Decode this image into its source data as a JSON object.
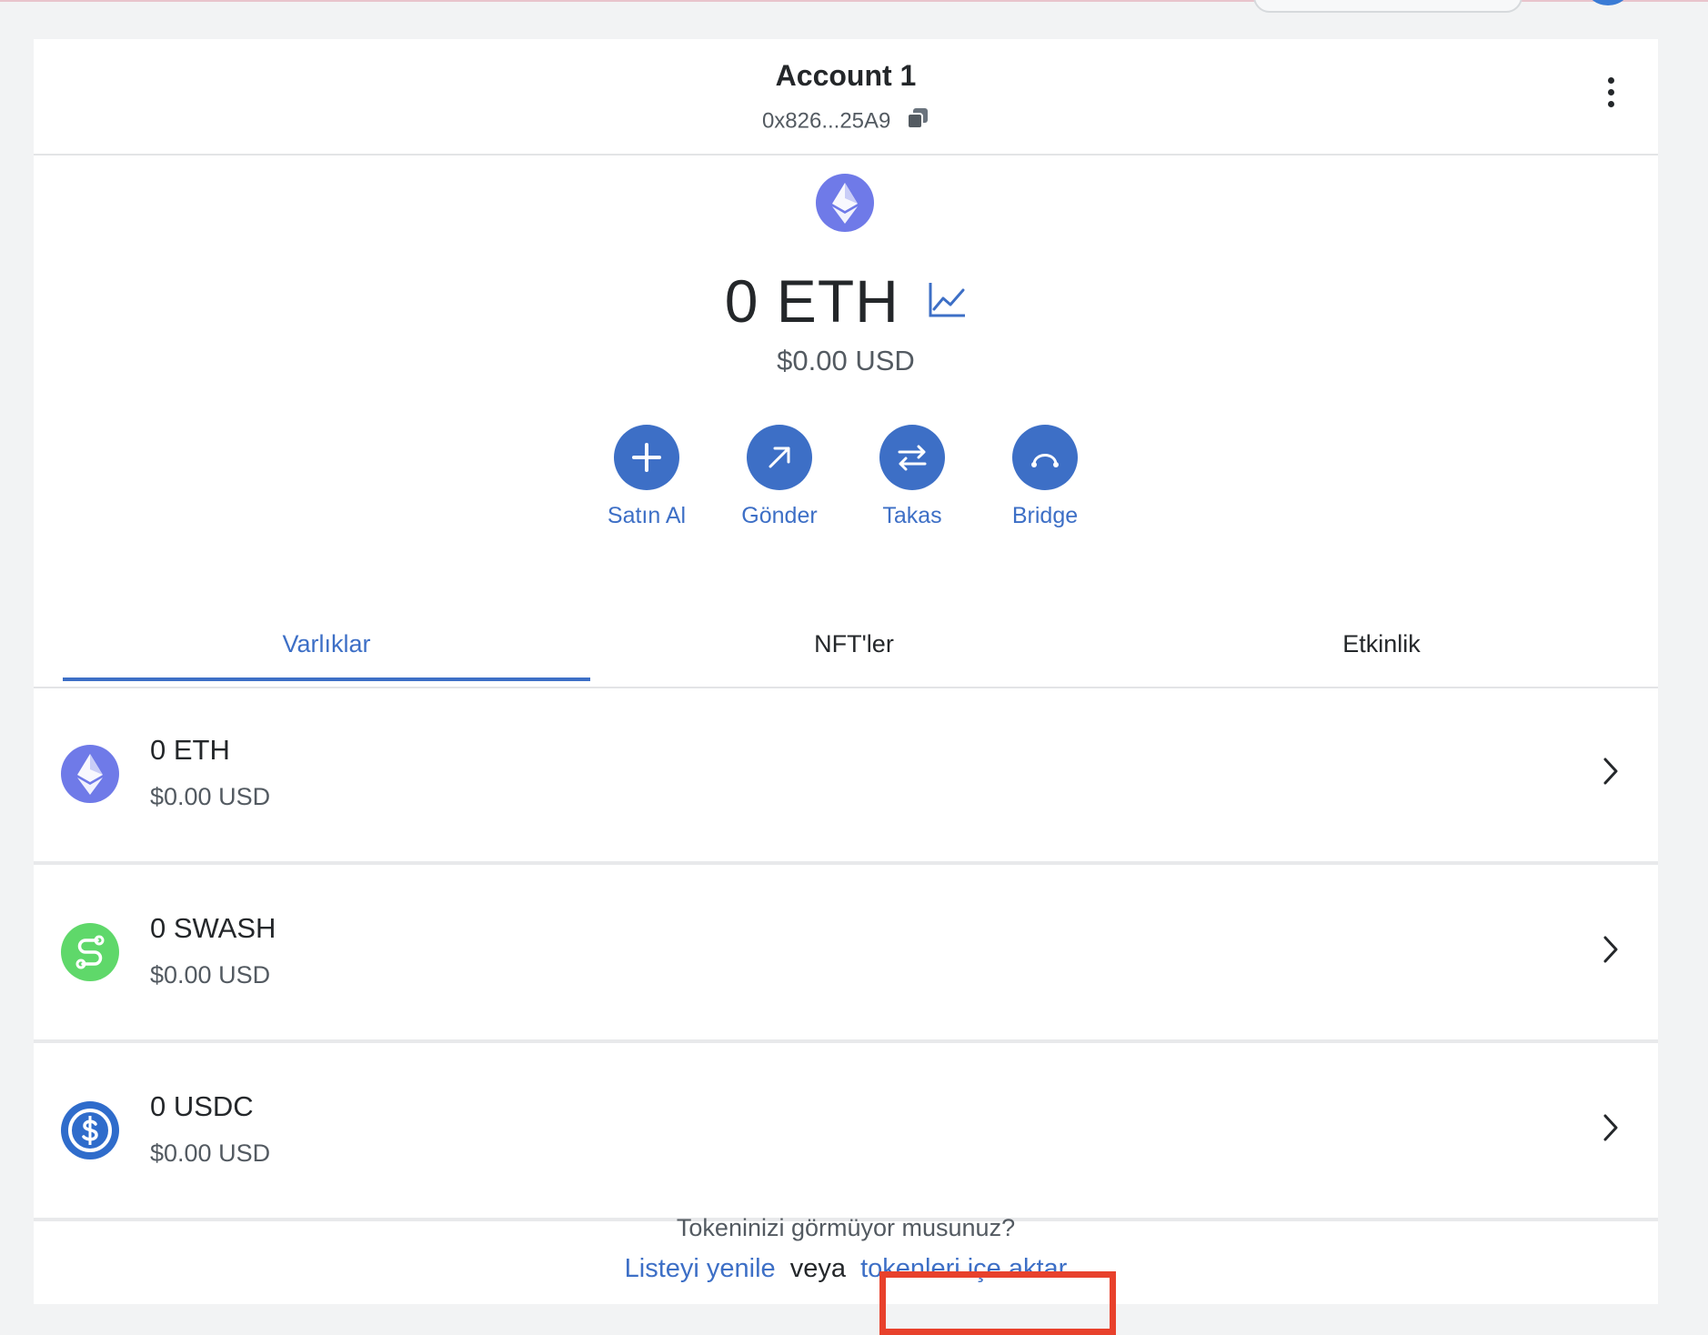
{
  "account": {
    "name": "Account 1",
    "address": "0x826...25A9"
  },
  "balance": {
    "amount": "0 ETH",
    "fiat": "$0.00 USD"
  },
  "actions": [
    {
      "label": "Satın Al"
    },
    {
      "label": "Gönder"
    },
    {
      "label": "Takas"
    },
    {
      "label": "Bridge"
    }
  ],
  "tabs": [
    {
      "label": "Varlıklar",
      "active": true
    },
    {
      "label": "NFT'ler",
      "active": false
    },
    {
      "label": "Etkinlik",
      "active": false
    }
  ],
  "assets": [
    {
      "amount": "0 ETH",
      "fiat": "$0.00 USD",
      "icon": "ethereum-icon"
    },
    {
      "amount": "0 SWASH",
      "fiat": "$0.00 USD",
      "icon": "swash-icon"
    },
    {
      "amount": "0 USDC",
      "fiat": "$0.00 USD",
      "icon": "usdc-icon"
    }
  ],
  "footer": {
    "question": "Tokeninizi görmüyor musunuz?",
    "refresh_link": "Listeyi yenile",
    "or": "veya",
    "import_link": "tokenleri içe aktar"
  },
  "colors": {
    "accent": "#3d6fc6",
    "eth": "#6f7ae8",
    "swash": "#5fd86a",
    "usdc": "#2f6ccb",
    "highlight": "#e8412c"
  }
}
